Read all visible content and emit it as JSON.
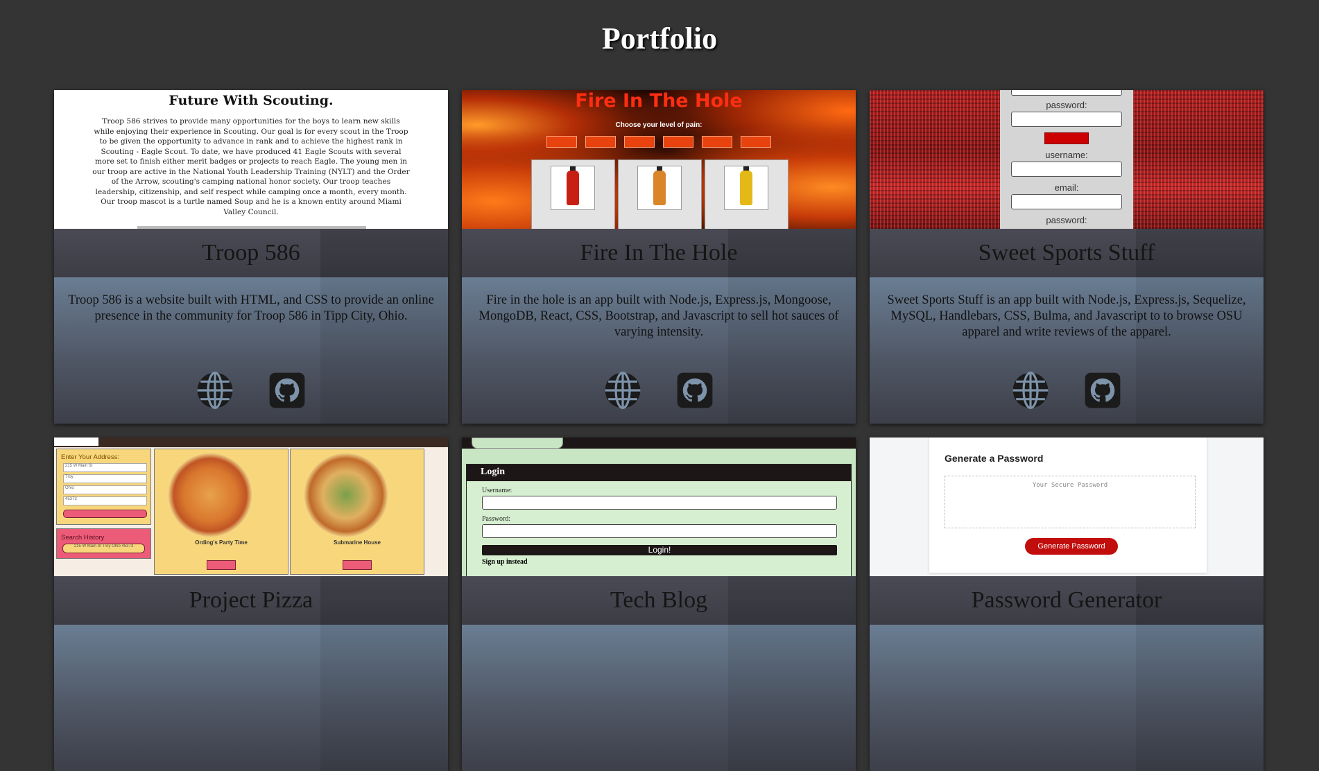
{
  "page": {
    "title": "Portfolio"
  },
  "projects": [
    {
      "name": "Troop 586",
      "description": "Troop 586 is a website built with HTML, and CSS to provide an online presence in the community for Troop 586 in Tipp City, Ohio.",
      "thumbnail": {
        "heading": "Future With Scouting.",
        "paragraph": "Troop 586 strives to provide many opportunities for the boys to learn new skills while enjoying their experience in Scouting. Our goal is for every scout in the Troop to be given the opportunity to advance in rank and to achieve the highest rank in Scouting - Eagle Scout. To date, we have produced 41 Eagle Scouts with several more set to finish either merit badges or projects to reach Eagle. The young men in our troop are active in the National Youth Leadership Training (NYLT) and the Order of the Arrow, scouting's camping national honor society. Our troop teaches leadership, citizenship, and self respect while camping once a month, every month. Our troop mascot is a turtle named Soup and he is a known entity around Miami Valley Council."
      },
      "links": {
        "site_icon": "globe-icon",
        "repo_icon": "github-icon"
      }
    },
    {
      "name": "Fire In The Hole",
      "description": "Fire in the hole is an app built with Node.js, Express.js, Mongoose, MongoDB, React, CSS, Bootstrap, and Javascript to sell hot sauces of varying intensity.",
      "thumbnail": {
        "heading": "Fire In The Hole",
        "subheading": "Choose your level of pain:",
        "sauce_colors": [
          "#c81f14",
          "#d9862a",
          "#e3b817"
        ]
      },
      "links": {
        "site_icon": "globe-icon",
        "repo_icon": "github-icon"
      }
    },
    {
      "name": "Sweet Sports Stuff",
      "description": "Sweet Sports Stuff is an app built with Node.js, Express.js, Sequelize, MySQL, Handlebars, CSS, Bulma, and Javascript to to browse OSU apparel and write reviews of the apparel.",
      "thumbnail": {
        "label_password": "password:",
        "label_username": "username:",
        "label_email": "email:"
      },
      "links": {
        "site_icon": "globe-icon",
        "repo_icon": "github-icon"
      }
    },
    {
      "name": "Project Pizza",
      "thumbnail": {
        "address_heading": "Enter Your Address:",
        "address_lines": [
          "215 W Main St",
          "Troy",
          "Ohio",
          "45373"
        ],
        "history_heading": "Search History",
        "history_item": "215 W Main St Troy Ohio 45373",
        "restaurant_1": "Ording's Party Time",
        "restaurant_2": "Submarine House"
      },
      "links": {
        "site_icon": "globe-icon",
        "repo_icon": "github-icon"
      }
    },
    {
      "name": "Tech Blog",
      "thumbnail": {
        "box_title": "Login",
        "username_label": "Username:",
        "password_label": "Password:",
        "button_label": "Login!",
        "signup_label": "Sign up instead"
      },
      "links": {
        "site_icon": "globe-icon",
        "repo_icon": "github-icon"
      }
    },
    {
      "name": "Password Generator",
      "thumbnail": {
        "heading": "Generate a Password",
        "placeholder": "Your Secure Password",
        "button_label": "Generate Password"
      },
      "links": {
        "site_icon": "globe-icon",
        "repo_icon": "github-icon"
      }
    }
  ]
}
